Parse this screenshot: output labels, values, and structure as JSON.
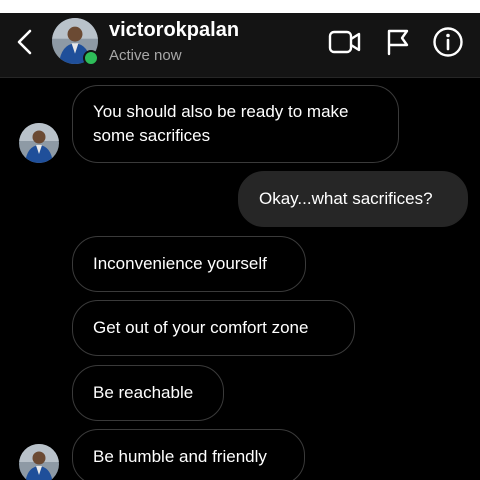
{
  "header": {
    "back_icon": "chevron-left-icon",
    "contact_name": "victorokpalan",
    "status": "Active now",
    "online_color": "#2ebd59",
    "icons": [
      "video-call-icon",
      "flag-icon",
      "info-icon"
    ]
  },
  "messages": [
    {
      "direction": "incoming",
      "line1": "You should also be ready to make",
      "line2": "some sacrifices"
    },
    {
      "direction": "outgoing",
      "text": "Okay...what sacrifices?"
    },
    {
      "direction": "incoming",
      "text": "Inconvenience yourself"
    },
    {
      "direction": "incoming",
      "text": "Get out of your comfort zone"
    },
    {
      "direction": "incoming",
      "text": "Be reachable"
    },
    {
      "direction": "incoming",
      "text": "Be humble and friendly"
    }
  ],
  "colors": {
    "background": "#000000",
    "header": "#141414",
    "incoming_border": "#3a3a3a",
    "outgoing_bubble": "#262626"
  }
}
